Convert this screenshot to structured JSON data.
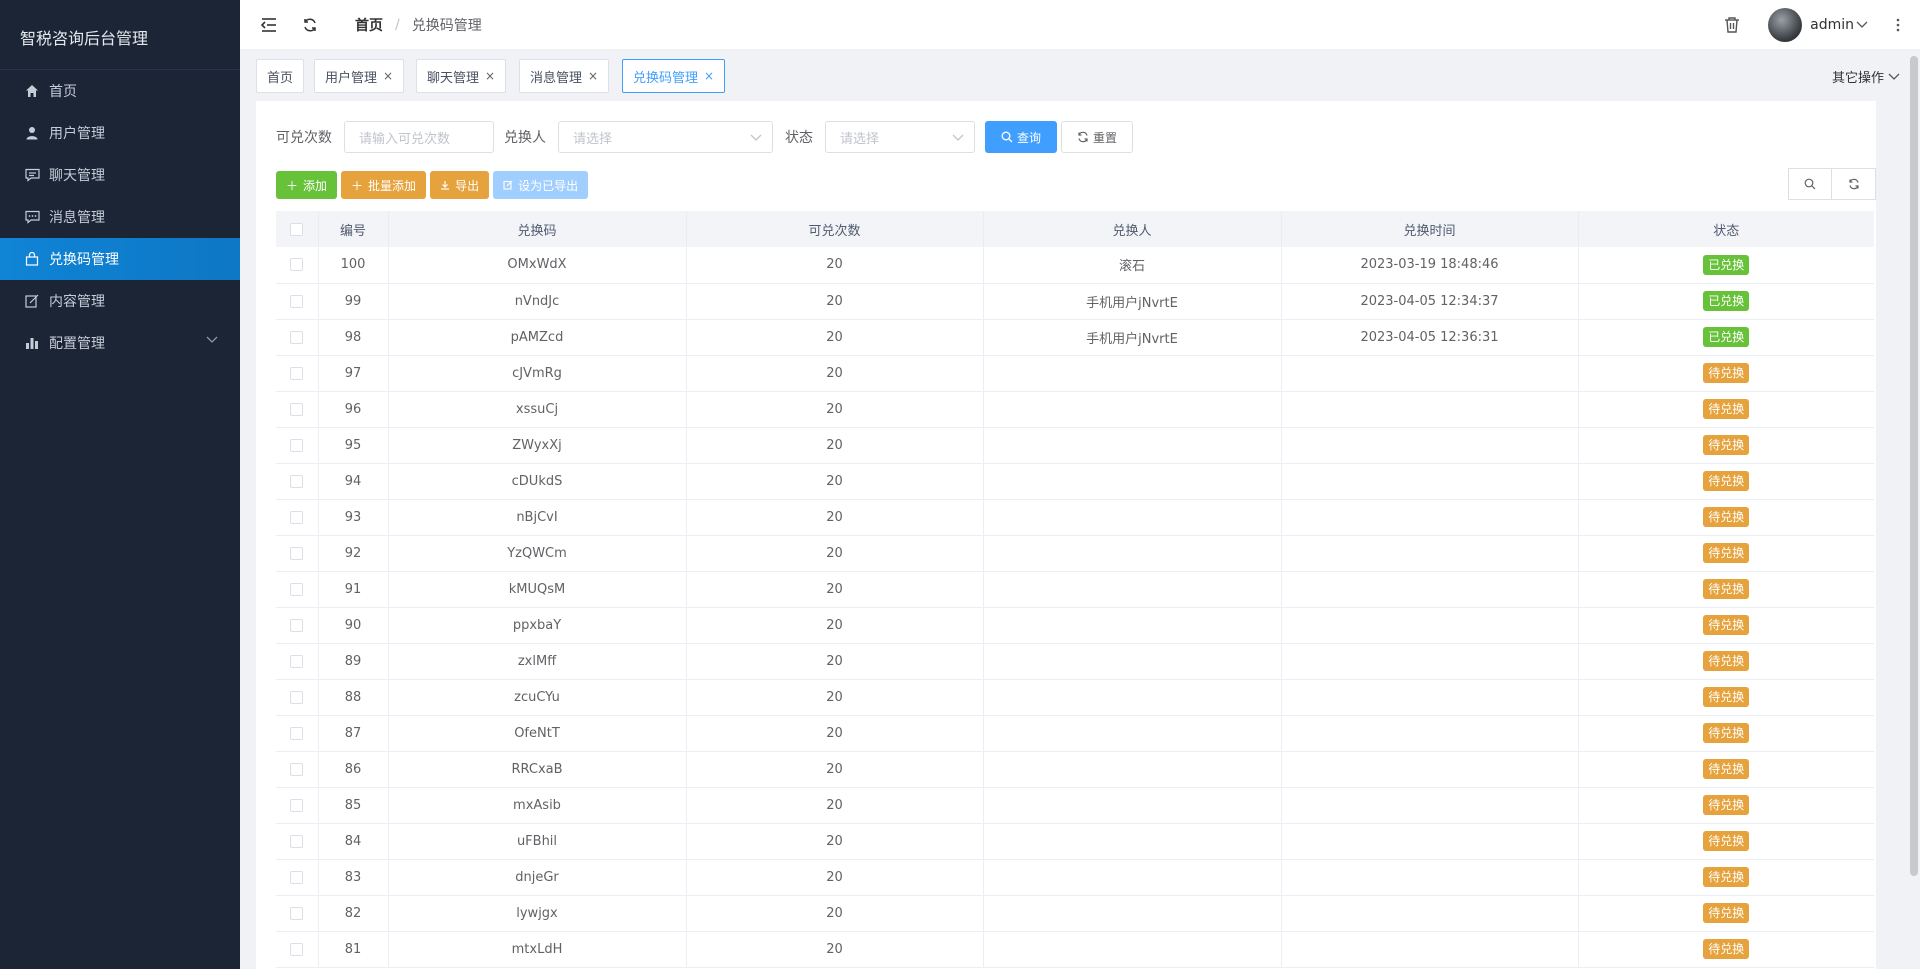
{
  "sidebar": {
    "title": "智税咨询后台管理",
    "items": [
      {
        "label": "首页",
        "icon": "home-icon"
      },
      {
        "label": "用户管理",
        "icon": "user-icon"
      },
      {
        "label": "聊天管理",
        "icon": "chat-icon"
      },
      {
        "label": "消息管理",
        "icon": "message-icon"
      },
      {
        "label": "兑换码管理",
        "icon": "bag-icon",
        "active": true
      },
      {
        "label": "内容管理",
        "icon": "edit-icon"
      },
      {
        "label": "配置管理",
        "icon": "chart-icon",
        "has_children": true
      }
    ]
  },
  "header": {
    "breadcrumb_home": "首页",
    "breadcrumb_sep": "/",
    "breadcrumb_current": "兑换码管理",
    "username": "admin"
  },
  "tags": [
    {
      "label": "首页",
      "closable": false
    },
    {
      "label": "用户管理",
      "closable": true
    },
    {
      "label": "聊天管理",
      "closable": true
    },
    {
      "label": "消息管理",
      "closable": true
    },
    {
      "label": "兑换码管理",
      "closable": true,
      "active": true
    }
  ],
  "tag_close": "×",
  "other_ops": "其它操作",
  "search": {
    "times_label": "可兑次数",
    "times_placeholder": "请输入可兑次数",
    "person_label": "兑换人",
    "person_placeholder": "请选择",
    "status_label": "状态",
    "status_placeholder": "请选择",
    "query_label": "查询",
    "reset_label": "重置"
  },
  "actions": {
    "add": "添加",
    "batch_add": "批量添加",
    "export": "导出",
    "mark_exported": "设为已导出"
  },
  "table": {
    "columns": [
      "编号",
      "兑换码",
      "可兑次数",
      "兑换人",
      "兑换时间",
      "状态"
    ],
    "rows": [
      {
        "id": "100",
        "code": "OMxWdX",
        "times": "20",
        "person": "滚石",
        "time": "2023-03-19 18:48:46",
        "status": "已兑换",
        "done": true
      },
      {
        "id": "99",
        "code": "nVndJc",
        "times": "20",
        "person": "手机用户jNvrtE",
        "time": "2023-04-05 12:34:37",
        "status": "已兑换",
        "done": true
      },
      {
        "id": "98",
        "code": "pAMZcd",
        "times": "20",
        "person": "手机用户jNvrtE",
        "time": "2023-04-05 12:36:31",
        "status": "已兑换",
        "done": true
      },
      {
        "id": "97",
        "code": "cJVmRg",
        "times": "20",
        "person": "",
        "time": "",
        "status": "待兑换",
        "done": false
      },
      {
        "id": "96",
        "code": "xssuCj",
        "times": "20",
        "person": "",
        "time": "",
        "status": "待兑换",
        "done": false
      },
      {
        "id": "95",
        "code": "ZWyxXj",
        "times": "20",
        "person": "",
        "time": "",
        "status": "待兑换",
        "done": false
      },
      {
        "id": "94",
        "code": "cDUkdS",
        "times": "20",
        "person": "",
        "time": "",
        "status": "待兑换",
        "done": false
      },
      {
        "id": "93",
        "code": "nBjCvI",
        "times": "20",
        "person": "",
        "time": "",
        "status": "待兑换",
        "done": false
      },
      {
        "id": "92",
        "code": "YzQWCm",
        "times": "20",
        "person": "",
        "time": "",
        "status": "待兑换",
        "done": false
      },
      {
        "id": "91",
        "code": "kMUQsM",
        "times": "20",
        "person": "",
        "time": "",
        "status": "待兑换",
        "done": false
      },
      {
        "id": "90",
        "code": "ppxbaY",
        "times": "20",
        "person": "",
        "time": "",
        "status": "待兑换",
        "done": false
      },
      {
        "id": "89",
        "code": "zxlMff",
        "times": "20",
        "person": "",
        "time": "",
        "status": "待兑换",
        "done": false
      },
      {
        "id": "88",
        "code": "zcuCYu",
        "times": "20",
        "person": "",
        "time": "",
        "status": "待兑换",
        "done": false
      },
      {
        "id": "87",
        "code": "OfeNtT",
        "times": "20",
        "person": "",
        "time": "",
        "status": "待兑换",
        "done": false
      },
      {
        "id": "86",
        "code": "RRCxaB",
        "times": "20",
        "person": "",
        "time": "",
        "status": "待兑换",
        "done": false
      },
      {
        "id": "85",
        "code": "mxAsib",
        "times": "20",
        "person": "",
        "time": "",
        "status": "待兑换",
        "done": false
      },
      {
        "id": "84",
        "code": "uFBhil",
        "times": "20",
        "person": "",
        "time": "",
        "status": "待兑换",
        "done": false
      },
      {
        "id": "83",
        "code": "dnjeGr",
        "times": "20",
        "person": "",
        "time": "",
        "status": "待兑换",
        "done": false
      },
      {
        "id": "82",
        "code": "lywjgx",
        "times": "20",
        "person": "",
        "time": "",
        "status": "待兑换",
        "done": false
      },
      {
        "id": "81",
        "code": "mtxLdH",
        "times": "20",
        "person": "",
        "time": "",
        "status": "待兑换",
        "done": false
      }
    ]
  },
  "colors": {
    "sidebar_bg": "#1c2535",
    "active_bg": "#1084d6",
    "primary": "#409eff",
    "success": "#67c23a",
    "warning": "#e6a23c"
  }
}
